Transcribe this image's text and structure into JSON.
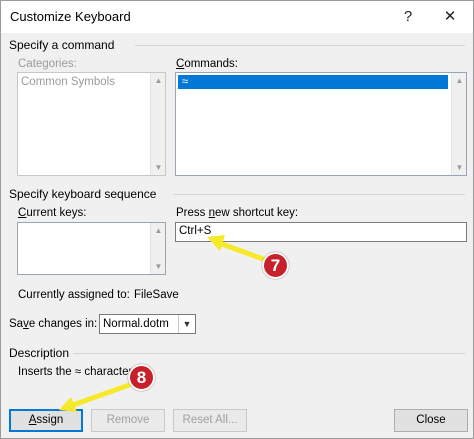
{
  "window": {
    "title": "Customize Keyboard",
    "help_glyph": "?",
    "close_glyph": "✕"
  },
  "command_section": {
    "title": "Specify a command",
    "categories_label": "Categories:",
    "categories_items": [
      "Common Symbols"
    ],
    "commands_label": "Commands:",
    "commands_items": [
      "≈"
    ],
    "commands_selected": "≈"
  },
  "keyboard_section": {
    "title": "Specify keyboard sequence",
    "current_keys_label": "Current keys:",
    "new_shortcut_label": "Press new shortcut key:",
    "new_shortcut_value": "Ctrl+S",
    "assigned_label": "Currently assigned to:",
    "assigned_value": "FileSave"
  },
  "save_changes": {
    "label": "Save changes in:",
    "selected": "Normal.dotm"
  },
  "description": {
    "title": "Description",
    "text": "Inserts the ≈ character"
  },
  "buttons": {
    "assign": "Assign",
    "remove": "Remove",
    "reset_all": "Reset All...",
    "close": "Close"
  },
  "annotations": {
    "step7": "7",
    "step8": "8",
    "arrow_color": "#f5e92a",
    "badge_color": "#c8202a"
  }
}
